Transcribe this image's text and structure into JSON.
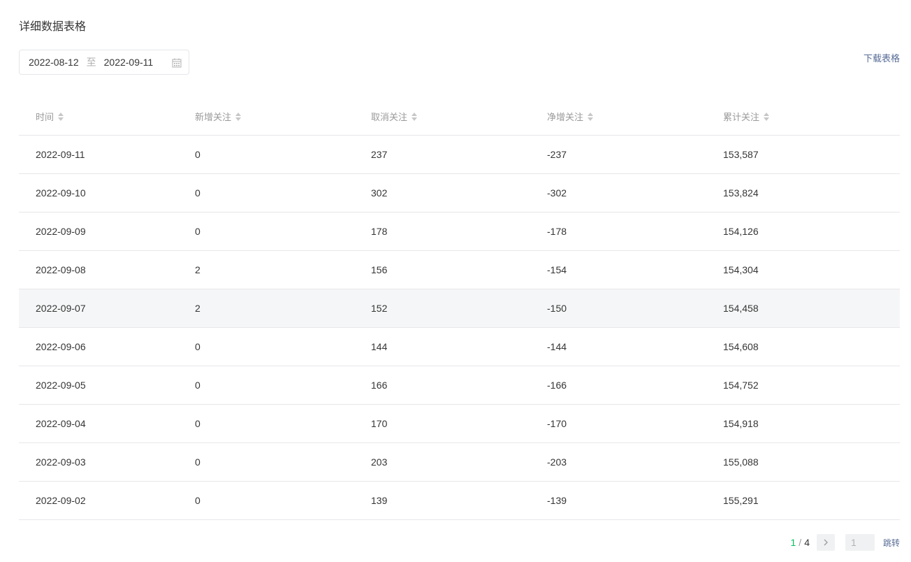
{
  "section": {
    "title": "详细数据表格"
  },
  "date_range": {
    "start": "2022-08-12",
    "separator": "至",
    "end": "2022-09-11",
    "icon": "calendar-icon"
  },
  "download": {
    "label": "下载表格"
  },
  "table": {
    "columns": [
      "时间",
      "新增关注",
      "取消关注",
      "净增关注",
      "累计关注"
    ],
    "sort_icon": "sort-icon",
    "rows": [
      [
        "2022-09-11",
        "0",
        "237",
        "-237",
        "153,587"
      ],
      [
        "2022-09-10",
        "0",
        "302",
        "-302",
        "153,824"
      ],
      [
        "2022-09-09",
        "0",
        "178",
        "-178",
        "154,126"
      ],
      [
        "2022-09-08",
        "2",
        "156",
        "-154",
        "154,304"
      ],
      [
        "2022-09-07",
        "2",
        "152",
        "-150",
        "154,458"
      ],
      [
        "2022-09-06",
        "0",
        "144",
        "-144",
        "154,608"
      ],
      [
        "2022-09-05",
        "0",
        "166",
        "-166",
        "154,752"
      ],
      [
        "2022-09-04",
        "0",
        "170",
        "-170",
        "154,918"
      ],
      [
        "2022-09-03",
        "0",
        "203",
        "-203",
        "155,088"
      ],
      [
        "2022-09-02",
        "0",
        "139",
        "-139",
        "155,291"
      ]
    ],
    "hovered_row": 4
  },
  "pagination": {
    "current": "1",
    "separator": "/",
    "total": "4",
    "next_icon": "chevron-right-icon",
    "input_placeholder": "1",
    "jump_label": "跳转"
  },
  "colors": {
    "accent": "#07c160",
    "link": "#576b95"
  }
}
